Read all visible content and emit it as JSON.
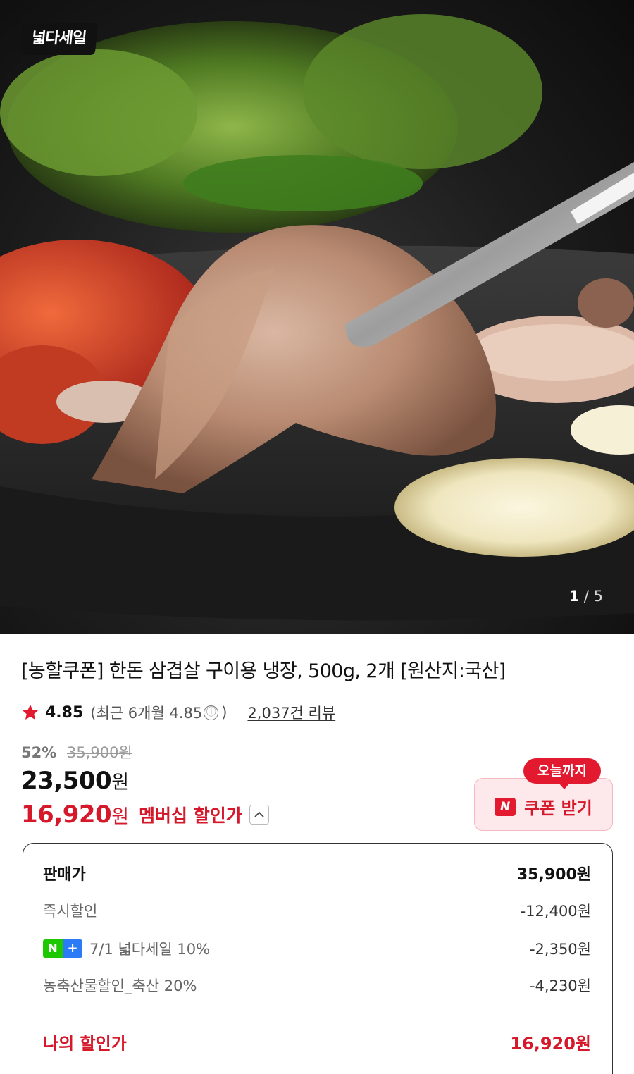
{
  "hero": {
    "brand_badge": "넓다세일",
    "pager_current": "1",
    "pager_total": "/ 5"
  },
  "product": {
    "title": "[농할쿠폰] 한돈 삼겹살 구이용 냉장, 500g, 2개 [원산지:국산]",
    "rating": {
      "star_icon": "star-icon",
      "score": "4.85",
      "recent_prefix": "(최근 6개월 4.85",
      "recent_suffix": ")",
      "info_icon": "ⓘ",
      "reviews": "2,037건 리뷰"
    },
    "discount_pct": "52%",
    "original_price": "35,900원",
    "price_value": "23,500",
    "price_unit": "원",
    "member_price_value": "16,920",
    "member_price_unit": "원",
    "member_label": "멤버십 할인가"
  },
  "coupon": {
    "tag": "오늘까지",
    "n_icon": "N",
    "label": "쿠폰 받기"
  },
  "breakdown": {
    "rows": [
      {
        "label": "판매가",
        "value": "35,900원"
      },
      {
        "label": "즉시할인",
        "value": "-12,400원"
      },
      {
        "badge_n": "N",
        "badge_plus": "+",
        "label": "7/1 넓다세일 10%",
        "value": "-2,350원"
      },
      {
        "label": "농축산물할인_축산 20%",
        "value": "-4,230원"
      }
    ],
    "total_label": "나의 할인가",
    "total_value": "16,920원"
  },
  "colors": {
    "accent_red": "#d5192b",
    "coupon_bg": "#fde9ec",
    "naver_green": "#1ec800",
    "plus_blue": "#2a7bf5"
  }
}
